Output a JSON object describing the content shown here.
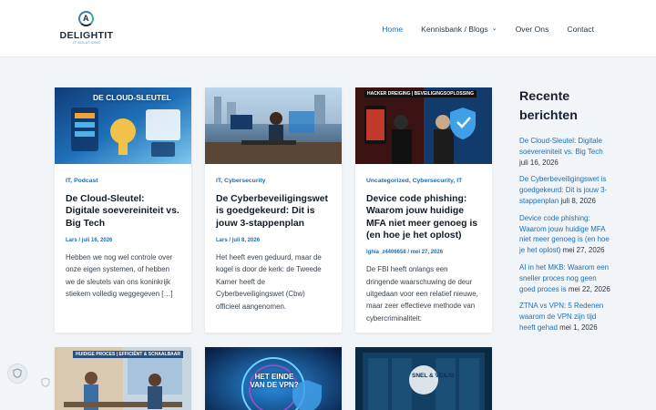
{
  "brand": {
    "name": "DELIGHTIT",
    "tagline": "IT SOLUTIONS"
  },
  "nav": {
    "items": [
      {
        "label": "Home",
        "active": true
      },
      {
        "label": "Kennisbank / Blogs",
        "has_dropdown": true
      },
      {
        "label": "Over Ons"
      },
      {
        "label": "Contact"
      }
    ]
  },
  "posts": [
    {
      "thumb_label": "DE CLOUD-SLEUTEL",
      "categories": "IT, Podcast",
      "title": "De Cloud-Sleutel: Digitale soevereiniteit vs. Big Tech",
      "meta": "Lars / juli 16, 2026",
      "excerpt": "Hebben we nog wel controle over onze eigen systemen, of hebben we de sleutels van ons koninkrijk stiekem volledig weggegeven […]"
    },
    {
      "thumb_label": "",
      "categories": "IT, Cybersecurity",
      "title": "De Cyberbeveiligingswet is goedgekeurd: Dit is jouw 3-stappenplan",
      "meta": "Lars / juli 8, 2026",
      "excerpt": "Het heeft even geduurd, maar de kogel is door de kerk: de Tweede Kamer heeft de Cyberbeveiligingswet (Cbw) officieel aangenomen."
    },
    {
      "thumb_label": "HACKER DREIGING  |  BEVEILIGINGSOPLOSSING",
      "categories": "Uncategorized, Cybersecurity, IT",
      "title": "Device code phishing: Waarom jouw huidige MFA niet meer genoeg is (en hoe je het oplost)",
      "meta": "lghia_z4406658 / mei 27, 2026",
      "excerpt": "De FBI heeft onlangs een dringende waarschuwing de deur uitgedaan voor een relatief nieuwe, maar zeer effectieve methode van cybercriminaliteit:"
    },
    {
      "thumb_label": "HUIDIGE PROCES  |  EFFICIËNT & SCHAALBAAR"
    },
    {
      "thumb_label": "HET EINDE VAN DE VPN?"
    },
    {
      "thumb_label": "SNEL & VEILIG"
    }
  ],
  "sidebar": {
    "title": "Recente berichten",
    "posts": [
      {
        "title": "De Cloud-Sleutel: Digitale soevereiniteit vs. Big Tech",
        "date": "juli 16, 2026"
      },
      {
        "title": "De Cyberbeveiligingswet is goedgekeurd: Dit is jouw 3-stappenplan",
        "date": "juli 8, 2026"
      },
      {
        "title": "Device code phishing: Waarom jouw huidige MFA niet meer genoeg is (en hoe je het oplost)",
        "date": "mei 27, 2026"
      },
      {
        "title": "AI in het MKB: Waarom een sneller proces nog geen goed proces is",
        "date": "mei 22, 2026"
      },
      {
        "title": "ZTNA vs VPN: 5 Redenen waarom de VPN zijn tijd heeft gehad",
        "date": "mei 1, 2026"
      }
    ]
  },
  "colors": {
    "accent": "#1a70b8",
    "background": "#f2f5f7",
    "heading": "#111c2a"
  },
  "icons": {
    "privacy": "shield-icon",
    "dropdown": "chevron-down-icon"
  }
}
